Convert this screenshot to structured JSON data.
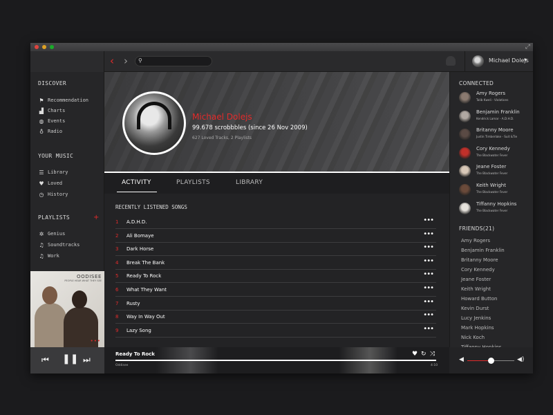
{
  "window": {
    "colors": {
      "accent": "#e32b2b",
      "background": "#232325"
    }
  },
  "topbar": {
    "back_icon": "chevron-left-icon",
    "forward_icon": "chevron-right-icon",
    "search_placeholder": "",
    "user_name": "Michael Dolejs"
  },
  "sidebar": {
    "discover_heading": "DISCOVER",
    "discover": [
      {
        "label": "Recommendation",
        "icon": "flag-icon"
      },
      {
        "label": "Charts",
        "icon": "bar-chart-icon"
      },
      {
        "label": "Events",
        "icon": "globe-icon"
      },
      {
        "label": "Radio",
        "icon": "microphone-icon"
      }
    ],
    "music_heading": "YOUR MUSIC",
    "music": [
      {
        "label": "Library",
        "icon": "list-icon"
      },
      {
        "label": "Loved",
        "icon": "heart-icon"
      },
      {
        "label": "History",
        "icon": "clock-icon"
      }
    ],
    "playlists_heading": "PLAYLISTS",
    "playlists": [
      {
        "label": "Genius",
        "icon": "atom-icon"
      },
      {
        "label": "Soundtracks",
        "icon": "music-note-icon"
      },
      {
        "label": "Work",
        "icon": "music-note-icon"
      }
    ]
  },
  "album": {
    "title": "OODISEE",
    "subtitle": "PEOPLE HEAR WHAT THEY SEE"
  },
  "profile": {
    "name": "Michael Dolejs",
    "scrobbles": "99.678 scrobbbles (since 26 Nov 2009)",
    "meta": "627 Loved Tracks, 2 Playlists"
  },
  "tabs": [
    {
      "label": "ACTIVITY",
      "active": true
    },
    {
      "label": "PLAYLISTS",
      "active": false
    },
    {
      "label": "LIBRARY",
      "active": false
    }
  ],
  "recent": {
    "title": "RECENTLY LISTENED SONGS",
    "songs": [
      {
        "num": "1",
        "title": "A.D.H.D."
      },
      {
        "num": "2",
        "title": "Ali Bomaye"
      },
      {
        "num": "3",
        "title": "Dark Horse"
      },
      {
        "num": "4",
        "title": "Break The Bank"
      },
      {
        "num": "5",
        "title": "Ready To Rock"
      },
      {
        "num": "6",
        "title": "What They Want"
      },
      {
        "num": "7",
        "title": "Rusty"
      },
      {
        "num": "8",
        "title": "Way In Way Out"
      },
      {
        "num": "9",
        "title": "Lazy Song"
      }
    ],
    "more_label": "•••"
  },
  "connected": {
    "heading": "CONNECTED",
    "people": [
      {
        "name": "Amy Rogers",
        "sub": "Talib Kweli - Violations",
        "color": "#8a7a70"
      },
      {
        "name": "Benjamin Franklin",
        "sub": "Kendrick Lamar - A.D.H.D.",
        "color": "#b0a8a2"
      },
      {
        "name": "Britanny Moore",
        "sub": "Justin Timberlake - Suit &Tie",
        "color": "#5a4a44"
      },
      {
        "name": "Cory Kennedy",
        "sub": "The Blackwater Fever",
        "color": "#c0302a"
      },
      {
        "name": "Jeane Foster",
        "sub": "The Blackwater Fever",
        "color": "#d8c8b8"
      },
      {
        "name": "Keith Wright",
        "sub": "The Blackwater Fever",
        "color": "#6a4a3a"
      },
      {
        "name": "Tiffanny Hopkins",
        "sub": "The Blackwater Fever",
        "color": "#e6e2dc"
      }
    ]
  },
  "friends": {
    "heading": "FRIENDS(21)",
    "list": [
      "Amy Rogers",
      "Benjamin Franklin",
      "Britanny Moore",
      "Cory Kennedy",
      "Jeane Foster",
      "Keith Wright",
      "Howard Button",
      "Kevin Durst",
      "Lucy Jenkins",
      "Mark Hopkins",
      "Nick Koch",
      "Tiffanny Hopkins"
    ]
  },
  "player": {
    "title": "Ready To Rock",
    "artist": "Oddisee",
    "time": "4:10",
    "volume": 0.5
  }
}
